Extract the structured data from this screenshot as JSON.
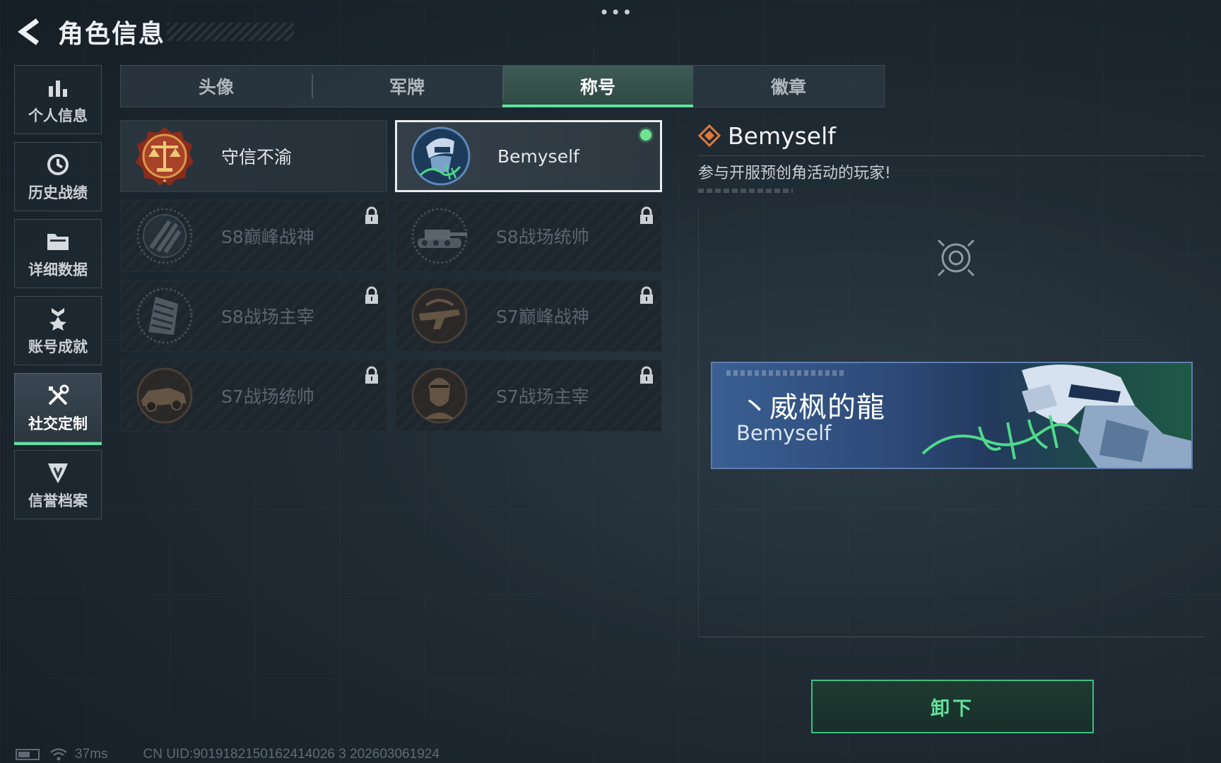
{
  "header": {
    "title": "角色信息",
    "dots": "•••"
  },
  "sidebar": {
    "items": [
      {
        "label": "个人信息",
        "icon": "bar-chart-icon"
      },
      {
        "label": "历史战绩",
        "icon": "history-icon"
      },
      {
        "label": "详细数据",
        "icon": "folder-icon"
      },
      {
        "label": "账号成就",
        "icon": "medal-icon"
      },
      {
        "label": "社交定制",
        "icon": "tools-icon",
        "active": true
      },
      {
        "label": "信誉档案",
        "icon": "shield-badge-icon"
      }
    ]
  },
  "tabs": [
    {
      "label": "头像"
    },
    {
      "label": "军牌"
    },
    {
      "label": "称号",
      "active": true
    },
    {
      "label": "徽章"
    }
  ],
  "titles": [
    {
      "name": "守信不渝",
      "locked": false,
      "emblem": "scales-emblem-icon"
    },
    {
      "name": "Bemyself",
      "locked": false,
      "selected": true,
      "equipped": true,
      "emblem": "soldier-emblem-icon"
    },
    {
      "name": "S8巅峰战神",
      "locked": true,
      "emblem": "stripes-emblem-icon"
    },
    {
      "name": "S8战场统帅",
      "locked": true,
      "emblem": "tank-emblem-icon"
    },
    {
      "name": "S8战场主宰",
      "locked": true,
      "emblem": "building-emblem-icon"
    },
    {
      "name": "S7巅峰战神",
      "locked": true,
      "emblem": "rifle-emblem-icon"
    },
    {
      "name": "S7战场统帅",
      "locked": true,
      "emblem": "vehicle-emblem-icon"
    },
    {
      "name": "S7战场主宰",
      "locked": true,
      "emblem": "soldier-head-emblem-icon"
    }
  ],
  "detail": {
    "title": "Bemyself",
    "description": "参与开服预创角活动的玩家!"
  },
  "nameplate": {
    "player_name": "丶威枫的龍",
    "title": "Bemyself"
  },
  "actions": {
    "unequip_label": "卸下"
  },
  "footer": {
    "ping": "37ms",
    "uid": "CN UID:9019182150162414026 3 202603061924"
  },
  "colors": {
    "accent": "#5fe0a0",
    "equipped_dot": "#6fe58f",
    "background": "#1f2a33",
    "nameplate_blue": "#2c4876"
  }
}
